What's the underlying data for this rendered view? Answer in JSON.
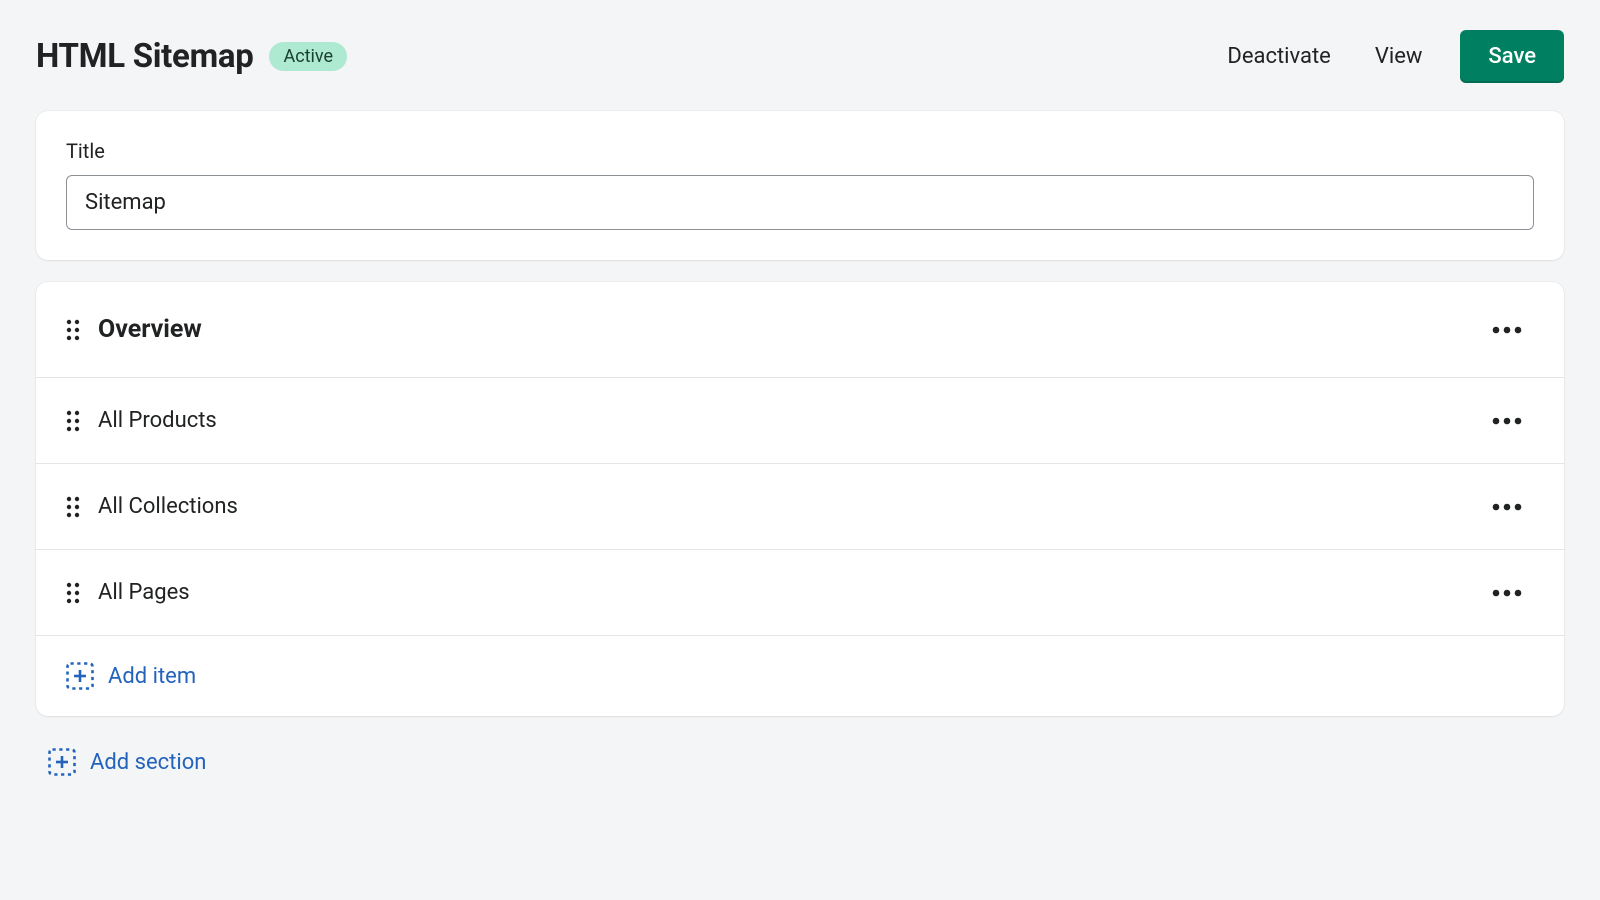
{
  "header": {
    "title": "HTML Sitemap",
    "status_badge": "Active",
    "deactivate_label": "Deactivate",
    "view_label": "View",
    "save_label": "Save"
  },
  "title_card": {
    "label": "Title",
    "value": "Sitemap"
  },
  "sections": [
    {
      "title": "Overview",
      "items": [
        {
          "label": "All Products"
        },
        {
          "label": "All Collections"
        },
        {
          "label": "All Pages"
        }
      ],
      "add_item_label": "Add item"
    }
  ],
  "add_section_label": "Add section"
}
